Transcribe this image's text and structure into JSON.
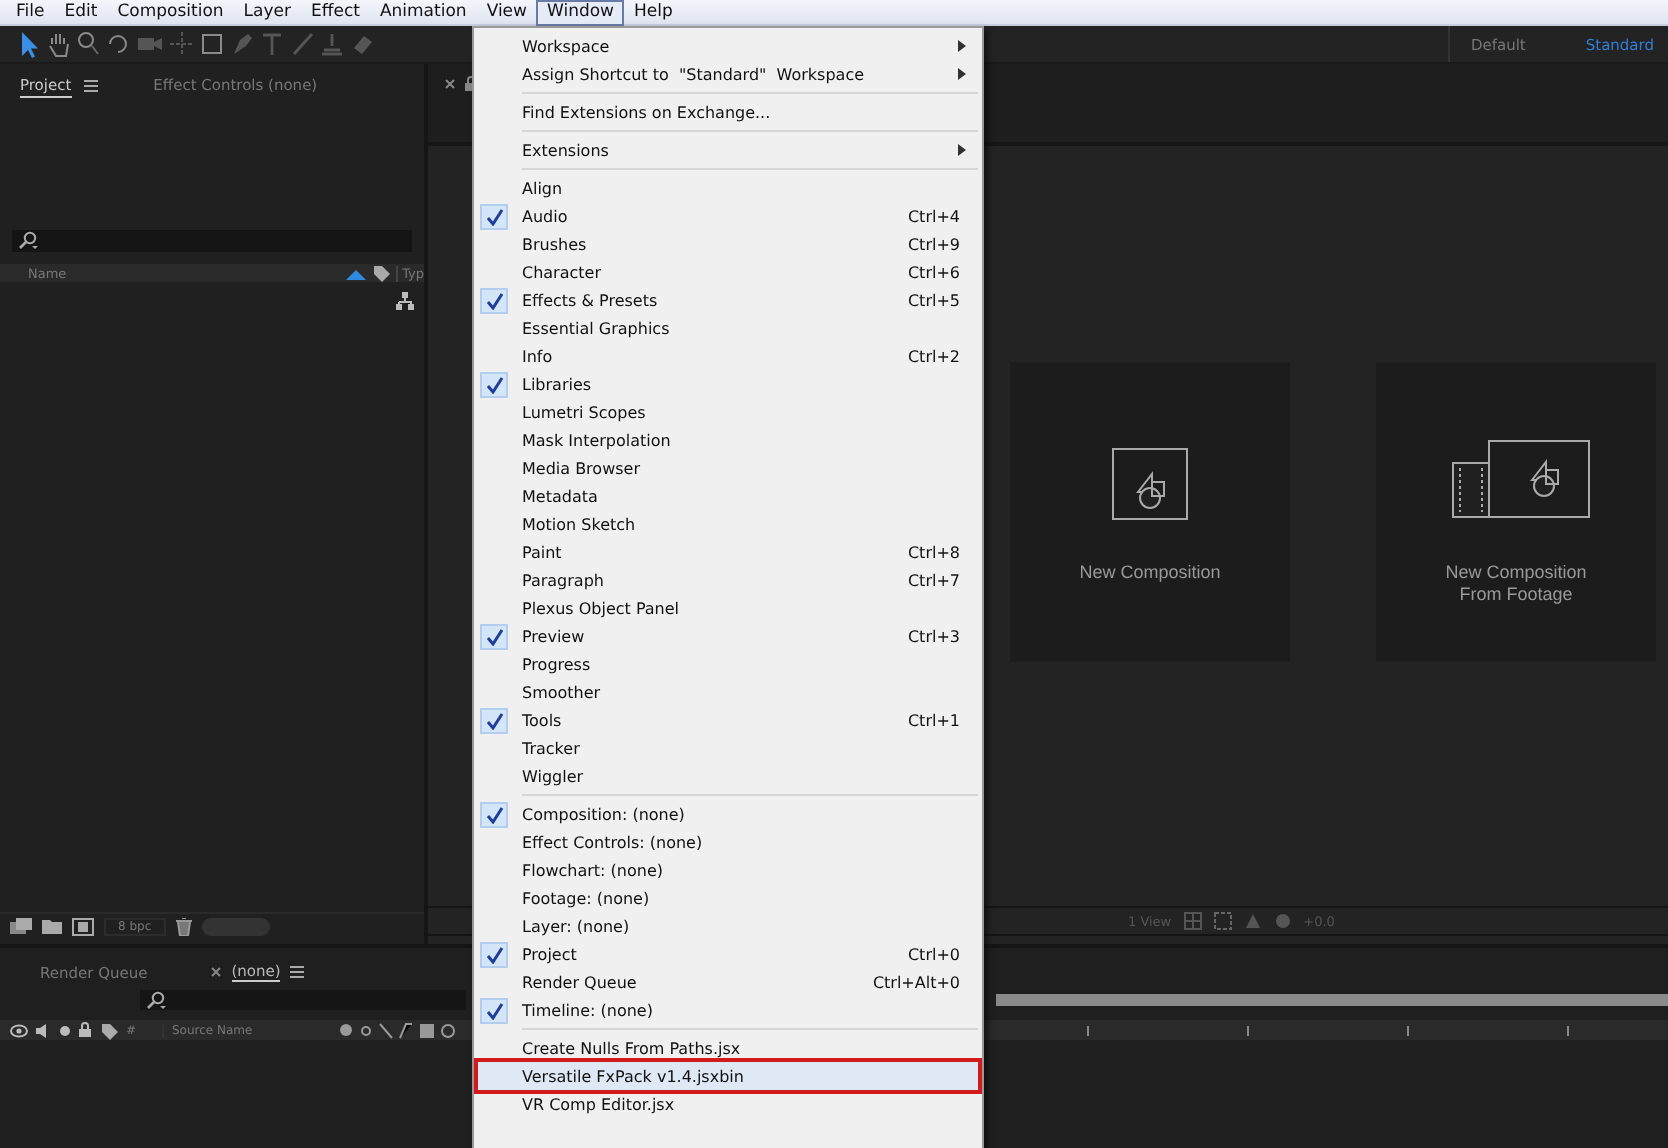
{
  "menubar": [
    {
      "label": "File",
      "selected": false
    },
    {
      "label": "Edit",
      "selected": false
    },
    {
      "label": "Composition",
      "selected": false
    },
    {
      "label": "Layer",
      "selected": false
    },
    {
      "label": "Effect",
      "selected": false
    },
    {
      "label": "Animation",
      "selected": false
    },
    {
      "label": "View",
      "selected": false
    },
    {
      "label": "Window",
      "selected": true
    },
    {
      "label": "Help",
      "selected": false
    }
  ],
  "workspaces": [
    {
      "label": "Default",
      "selected": false
    },
    {
      "label": "Standard",
      "selected": true
    }
  ],
  "project_panel": {
    "tabs": [
      {
        "label": "Project",
        "selected": true
      },
      {
        "label": "Effect Controls (none)",
        "selected": false
      }
    ],
    "columns": [
      "Name",
      "Typ"
    ],
    "bit_depth": "8 bpc"
  },
  "composition_panel": {
    "cards": [
      {
        "kind": "new",
        "label": "New Composition"
      },
      {
        "kind": "footage",
        "label": "New Composition\nFrom Footage"
      }
    ],
    "view_label": "1 View",
    "exposure": "+0.0"
  },
  "timeline": {
    "tabs": [
      {
        "label": "Render Queue",
        "selected": false
      },
      {
        "label": "(none)",
        "selected": true
      }
    ],
    "columns": [
      "#",
      "Source Name"
    ]
  },
  "window_menu": {
    "sections": [
      [
        {
          "label": "Workspace",
          "kind": "submenu",
          "checked": false,
          "selected": false
        },
        {
          "label": "Assign Shortcut to  \"Standard\"  Workspace",
          "kind": "submenu",
          "checked": false,
          "selected": false
        }
      ],
      [
        {
          "label": "Find Extensions on Exchange...",
          "kind": "command",
          "checked": false,
          "selected": false
        }
      ],
      [
        {
          "label": "Extensions",
          "kind": "submenu",
          "checked": false,
          "selected": false
        }
      ],
      [
        {
          "label": "Align",
          "kind": "command",
          "checked": false,
          "selected": false
        },
        {
          "label": "Audio",
          "kind": "command",
          "shortcut": "Ctrl+4",
          "checked": true,
          "selected": false
        },
        {
          "label": "Brushes",
          "kind": "command",
          "shortcut": "Ctrl+9",
          "checked": false,
          "selected": false
        },
        {
          "label": "Character",
          "kind": "command",
          "shortcut": "Ctrl+6",
          "checked": false,
          "selected": false
        },
        {
          "label": "Effects & Presets",
          "kind": "command",
          "shortcut": "Ctrl+5",
          "checked": true,
          "selected": false
        },
        {
          "label": "Essential Graphics",
          "kind": "command",
          "checked": false,
          "selected": false
        },
        {
          "label": "Info",
          "kind": "command",
          "shortcut": "Ctrl+2",
          "checked": false,
          "selected": false
        },
        {
          "label": "Libraries",
          "kind": "command",
          "checked": true,
          "selected": false
        },
        {
          "label": "Lumetri Scopes",
          "kind": "command",
          "checked": false,
          "selected": false
        },
        {
          "label": "Mask Interpolation",
          "kind": "command",
          "checked": false,
          "selected": false
        },
        {
          "label": "Media Browser",
          "kind": "command",
          "checked": false,
          "selected": false
        },
        {
          "label": "Metadata",
          "kind": "command",
          "checked": false,
          "selected": false
        },
        {
          "label": "Motion Sketch",
          "kind": "command",
          "checked": false,
          "selected": false
        },
        {
          "label": "Paint",
          "kind": "command",
          "shortcut": "Ctrl+8",
          "checked": false,
          "selected": false
        },
        {
          "label": "Paragraph",
          "kind": "command",
          "shortcut": "Ctrl+7",
          "checked": false,
          "selected": false
        },
        {
          "label": "Plexus Object Panel",
          "kind": "command",
          "checked": false,
          "selected": false
        },
        {
          "label": "Preview",
          "kind": "command",
          "shortcut": "Ctrl+3",
          "checked": true,
          "selected": false
        },
        {
          "label": "Progress",
          "kind": "command",
          "checked": false,
          "selected": false
        },
        {
          "label": "Smoother",
          "kind": "command",
          "checked": false,
          "selected": false
        },
        {
          "label": "Tools",
          "kind": "command",
          "shortcut": "Ctrl+1",
          "checked": true,
          "selected": false
        },
        {
          "label": "Tracker",
          "kind": "command",
          "checked": false,
          "selected": false
        },
        {
          "label": "Wiggler",
          "kind": "command",
          "checked": false,
          "selected": false
        }
      ],
      [
        {
          "label": "Composition: (none)",
          "kind": "command",
          "checked": true,
          "selected": false
        },
        {
          "label": "Effect Controls: (none)",
          "kind": "command",
          "checked": false,
          "selected": false
        },
        {
          "label": "Flowchart: (none)",
          "kind": "command",
          "checked": false,
          "selected": false
        },
        {
          "label": "Footage: (none)",
          "kind": "command",
          "checked": false,
          "selected": false
        },
        {
          "label": "Layer: (none)",
          "kind": "command",
          "checked": false,
          "selected": false
        },
        {
          "label": "Project",
          "kind": "command",
          "shortcut": "Ctrl+0",
          "checked": true,
          "selected": false
        },
        {
          "label": "Render Queue",
          "kind": "command",
          "shortcut": "Ctrl+Alt+0",
          "checked": false,
          "selected": false
        },
        {
          "label": "Timeline: (none)",
          "kind": "command",
          "checked": true,
          "selected": false
        }
      ],
      [
        {
          "label": "Create Nulls From Paths.jsx",
          "kind": "command",
          "checked": false,
          "selected": false
        },
        {
          "label": "Versatile FxPack v1.4.jsxbin",
          "kind": "command",
          "checked": false,
          "selected": true
        },
        {
          "label": "VR Comp Editor.jsx",
          "kind": "command",
          "checked": false,
          "selected": false
        }
      ]
    ]
  }
}
